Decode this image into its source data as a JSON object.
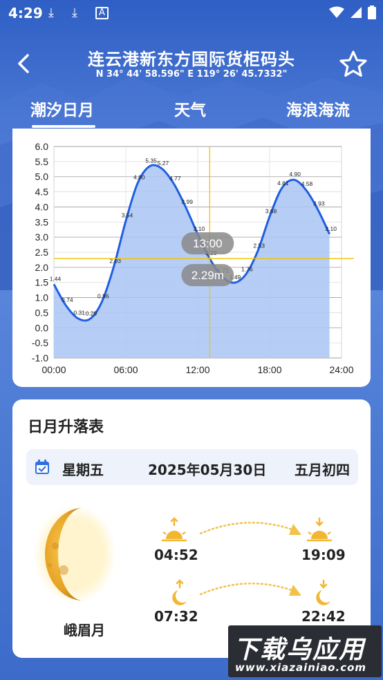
{
  "status_bar": {
    "time": "4:29",
    "icons": [
      "download-icon",
      "download-icon",
      "font-icon",
      "wifi-icon",
      "signal-icon",
      "battery-icon"
    ]
  },
  "header": {
    "title": "连云港新东方国际货柜码头",
    "coordinates": "N 34° 44' 58.596\"   E 119° 26' 45.7332\""
  },
  "tabs": [
    {
      "label": "潮汐日月",
      "active": true
    },
    {
      "label": "天气",
      "active": false
    },
    {
      "label": "海浪海流",
      "active": false
    }
  ],
  "tide_chart": {
    "cursor_time": "13:00",
    "cursor_value": "2.29m"
  },
  "chart_data": {
    "type": "area",
    "y_ticks": [
      "6.0",
      "5.5",
      "5.0",
      "4.5",
      "4.0",
      "3.5",
      "3.0",
      "2.5",
      "2.0",
      "1.5",
      "1.0",
      "0.5",
      "0.0",
      "-0.5",
      "-1.0"
    ],
    "x_ticks": [
      "00:00",
      "06:00",
      "12:00",
      "18:00",
      "24:00"
    ],
    "ylim": [
      -1.0,
      6.0
    ],
    "xlim": [
      0,
      24
    ],
    "x": [
      0,
      1,
      2,
      3,
      4,
      5,
      6,
      7,
      8,
      9,
      10,
      11,
      12,
      13,
      14,
      15,
      16,
      17,
      18,
      19,
      20,
      21,
      22,
      23
    ],
    "y": [
      1.44,
      0.74,
      0.31,
      0.29,
      0.86,
      2.03,
      3.54,
      4.8,
      5.35,
      5.27,
      4.77,
      3.99,
      3.1,
      2.29,
      1.71,
      1.49,
      1.76,
      2.53,
      3.68,
      4.61,
      4.9,
      4.58,
      3.93,
      3.1
    ],
    "point_labels": [
      "1.44",
      "0.74",
      "0.31",
      "0.29",
      "0.86",
      "2.03",
      "3.54",
      "4.80",
      "5.35",
      "5.27",
      "4.77",
      "3.99",
      "3.10",
      "2.29",
      "1.71",
      "1.49",
      "1.76",
      "2.53",
      "3.68",
      "4.61",
      "4.90",
      "4.58",
      "3.93",
      "3.10"
    ],
    "crosshair": {
      "x": 13,
      "y": 2.29
    },
    "colors": {
      "line": "#1f5ee0",
      "fill": "#a9c4f5",
      "crosshair": "#f2c200"
    }
  },
  "sun_moon": {
    "title": "日月升落表",
    "weekday": "星期五",
    "date": "2025年05月30日",
    "lunar_date": "五月初四",
    "moon_phase": "峨眉月",
    "sunrise": "04:52",
    "sunset": "19:09",
    "moonrise": "07:32",
    "moonset": "22:42"
  },
  "watermark": {
    "title": "下载乌应用",
    "url": "www.xiazainiao.com"
  }
}
